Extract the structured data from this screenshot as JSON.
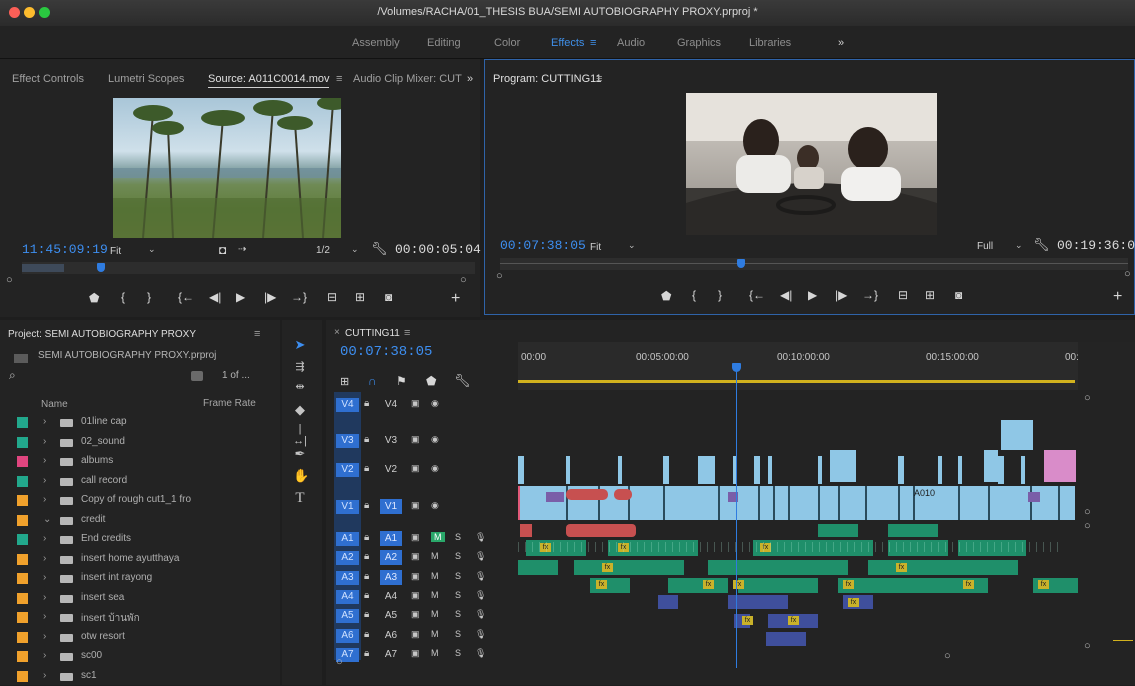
{
  "window": {
    "title": "/Volumes/RACHA/01_THESIS BUA/SEMI AUTOBIOGRAPHY PROXY.prproj *",
    "workspaces": [
      "Assembly",
      "Editing",
      "Color",
      "Effects",
      "Audio",
      "Graphics",
      "Libraries"
    ],
    "active_workspace": "Effects",
    "workspace_menu_glyph": "≡",
    "overflow_glyph": "»"
  },
  "source_monitor": {
    "tabs": [
      "Effect Controls",
      "Lumetri Scopes",
      "Source: A011C0014.mov",
      "Audio Clip Mixer: CUT"
    ],
    "active_tab": "Source: A011C0014.mov",
    "menu_glyph": "≡",
    "overflow_glyph": "»",
    "timecode": "11:45:09:19",
    "zoom": "Fit",
    "resolution": "1/2",
    "duration": "00:00:05:04",
    "playhead_fraction": 0.12,
    "image_description": "palm trees beach",
    "settings_icon": "wrench-icon",
    "add_glyph": "+"
  },
  "program_monitor": {
    "tab": "Program: CUTTING11",
    "menu_glyph": "≡",
    "timecode": "00:07:38:05",
    "zoom": "Fit",
    "resolution": "Full",
    "duration": "00:19:36:01",
    "playhead_fraction": 0.4,
    "settings_icon": "wrench-icon",
    "add_glyph": "+"
  },
  "project": {
    "title": "Project: SEMI AUTOBIOGRAPHY PROXY",
    "menu_glyph": "≡",
    "file": "SEMI AUTOBIOGRAPHY PROXY.prproj",
    "count": "1 of ...",
    "col_name": "Name",
    "col_frame_rate": "Frame Rate",
    "items": [
      {
        "name": "01line cap",
        "color": "#22a88c",
        "expanded": false
      },
      {
        "name": "02_sound",
        "color": "#22a88c",
        "expanded": false
      },
      {
        "name": "albums",
        "color": "#e0457f",
        "expanded": false
      },
      {
        "name": "call record",
        "color": "#22a88c",
        "expanded": false
      },
      {
        "name": "Copy of rough cut1_1 fro",
        "color": "#f0a12c",
        "expanded": false
      },
      {
        "name": "credit",
        "color": "#f0a12c",
        "expanded": true
      },
      {
        "name": "End credits",
        "color": "#22a88c",
        "expanded": false
      },
      {
        "name": "insert home ayutthaya",
        "color": "#f0a12c",
        "expanded": false
      },
      {
        "name": "insert int rayong",
        "color": "#f0a12c",
        "expanded": false
      },
      {
        "name": "insert sea",
        "color": "#f0a12c",
        "expanded": false
      },
      {
        "name": "insert บ้านพัก",
        "color": "#f0a12c",
        "expanded": false
      },
      {
        "name": "otw resort",
        "color": "#f0a12c",
        "expanded": false
      },
      {
        "name": "sc00",
        "color": "#f0a12c",
        "expanded": false
      },
      {
        "name": "sc1",
        "color": "#f0a12c",
        "expanded": false
      }
    ]
  },
  "timeline": {
    "sequence_tab": "CUTTING11",
    "menu_glyph": "≡",
    "close_glyph": "×",
    "timecode": "00:07:38:05",
    "ruler_labels": [
      "00:00",
      "00:05:00:00",
      "00:10:00:00",
      "00:15:00:00",
      "00:"
    ],
    "video_tracks": [
      "V4",
      "V3",
      "V2",
      "V1"
    ],
    "audio_tracks": [
      "A1",
      "A2",
      "A3",
      "A4",
      "A5",
      "A6",
      "A7"
    ],
    "mute_label": "M",
    "solo_label": "S",
    "clip_label": "A010",
    "fx_badge": "fx",
    "playhead_fraction": 0.39,
    "colors": {
      "video_clip": "#8fc7e6",
      "pink_clip": "#d98cc9",
      "audio_clip": "#1f8f6a",
      "blue_accent": "#2f7ce0"
    }
  }
}
